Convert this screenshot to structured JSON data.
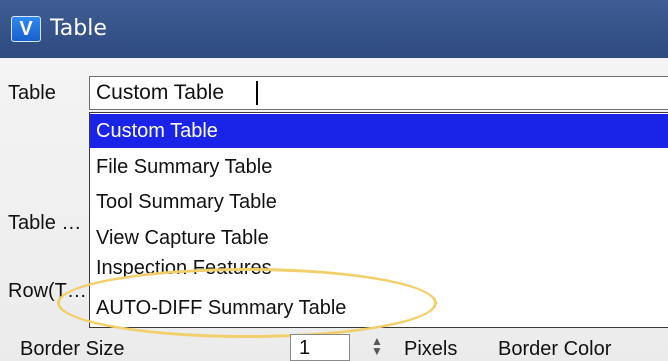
{
  "window": {
    "title": "Table",
    "logo_glyph": "V"
  },
  "form": {
    "table_label": "Table",
    "table_value": "Custom Table",
    "table_type_label": "Table …",
    "row_label": "Row(T…",
    "border_size_label": "Border Size",
    "border_size_value": "1",
    "border_size_unit": "Pixels",
    "border_color_label": "Border Color"
  },
  "dropdown": {
    "options": [
      "Custom Table",
      "File Summary Table",
      "Tool Summary Table",
      "View Capture Table",
      "Inspection Features",
      "AUTO-DIFF Summary Table"
    ],
    "selected_index": 0
  },
  "colors": {
    "title_bar": "#2e4a80",
    "selection": "#1a24e8",
    "highlight_ellipse": "#f1cf6a"
  }
}
